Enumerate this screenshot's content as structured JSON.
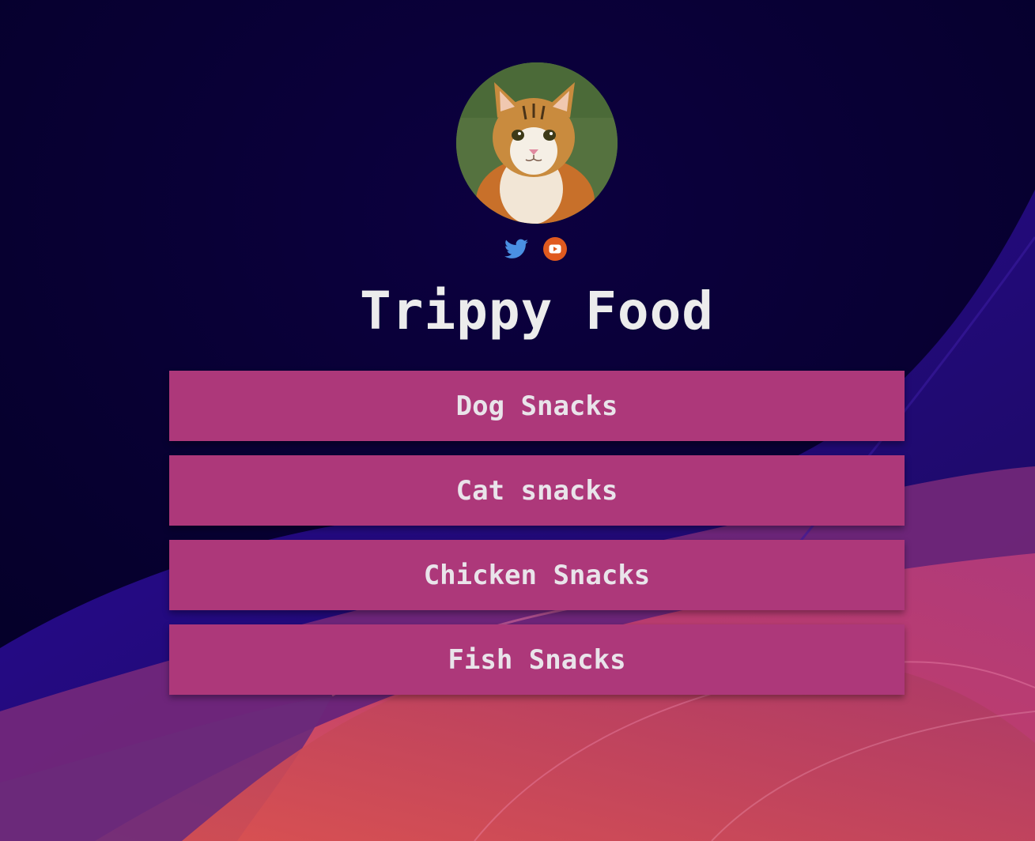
{
  "profile": {
    "title": "Trippy Food",
    "avatar_icon": "cat-photo"
  },
  "social": [
    {
      "name": "Twitter",
      "icon": "twitter-bird-icon",
      "color": "#4a90e2"
    },
    {
      "name": "YouTube",
      "icon": "youtube-play-icon",
      "color": "#e05a1f"
    }
  ],
  "links": [
    {
      "label": "Dog Snacks"
    },
    {
      "label": "Cat snacks"
    },
    {
      "label": "Chicken Snacks"
    },
    {
      "label": "Fish Snacks"
    }
  ],
  "colors": {
    "background": "#07002e",
    "button": "#ad387a",
    "button_text": "#e9e4ea",
    "title_text": "#ececec"
  }
}
